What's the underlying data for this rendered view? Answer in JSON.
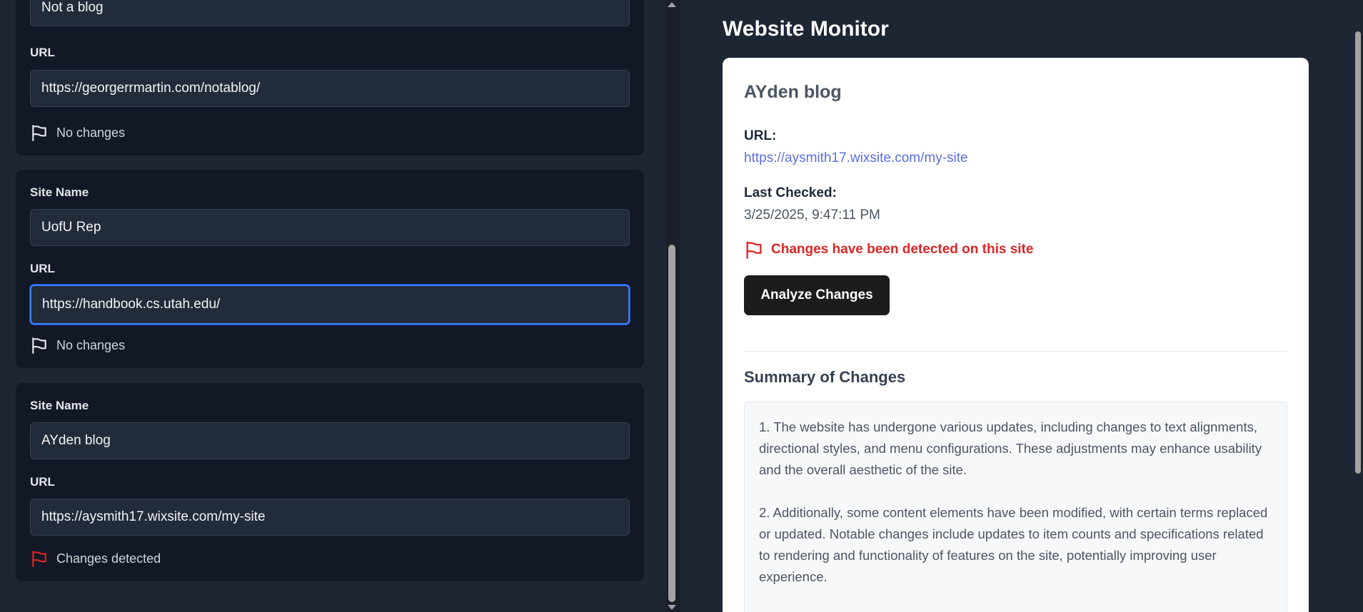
{
  "left": {
    "cards": [
      {
        "site_name_label": "",
        "site_name": "Not a blog",
        "url_label": "URL",
        "url": "https://georgerrmartin.com/notablog/",
        "status": "No changes",
        "status_color": "#d1d5db"
      },
      {
        "site_name_label": "Site Name",
        "site_name": "UofU Rep",
        "url_label": "URL",
        "url": "https://handbook.cs.utah.edu/",
        "status": "No changes",
        "status_color": "#d1d5db"
      },
      {
        "site_name_label": "Site Name",
        "site_name": "AYden blog",
        "url_label": "URL",
        "url": "https://aysmith17.wixsite.com/my-site",
        "status": "Changes detected",
        "status_color": "#dc2626"
      }
    ]
  },
  "right": {
    "app_title": "Website Monitor",
    "detail": {
      "site_name": "AYden blog",
      "url_label": "URL:",
      "url": "https://aysmith17.wixsite.com/my-site",
      "last_checked_label": "Last Checked:",
      "last_checked": "3/25/2025, 9:47:11 PM",
      "alert": "Changes have been detected on this site",
      "analyze_button": "Analyze Changes",
      "summary_heading": "Summary of Changes",
      "summary_paragraphs": [
        "1. The website has undergone various updates, including changes to text alignments, directional styles, and menu configurations. These adjustments may enhance usability and the overall aesthetic of the site.",
        "2. Additionally, some content elements have been modified, with certain terms replaced or updated. Notable changes include updates to item counts and specifications related to rendering and functionality of features on the site, potentially improving user experience."
      ]
    }
  },
  "colors": {
    "background": "#1e2533",
    "card_background": "#121826",
    "input_background": "#222b3a",
    "focus_ring": "#3b82f6",
    "alert_red": "#dc2626",
    "link_blue": "#5b6ee1"
  }
}
